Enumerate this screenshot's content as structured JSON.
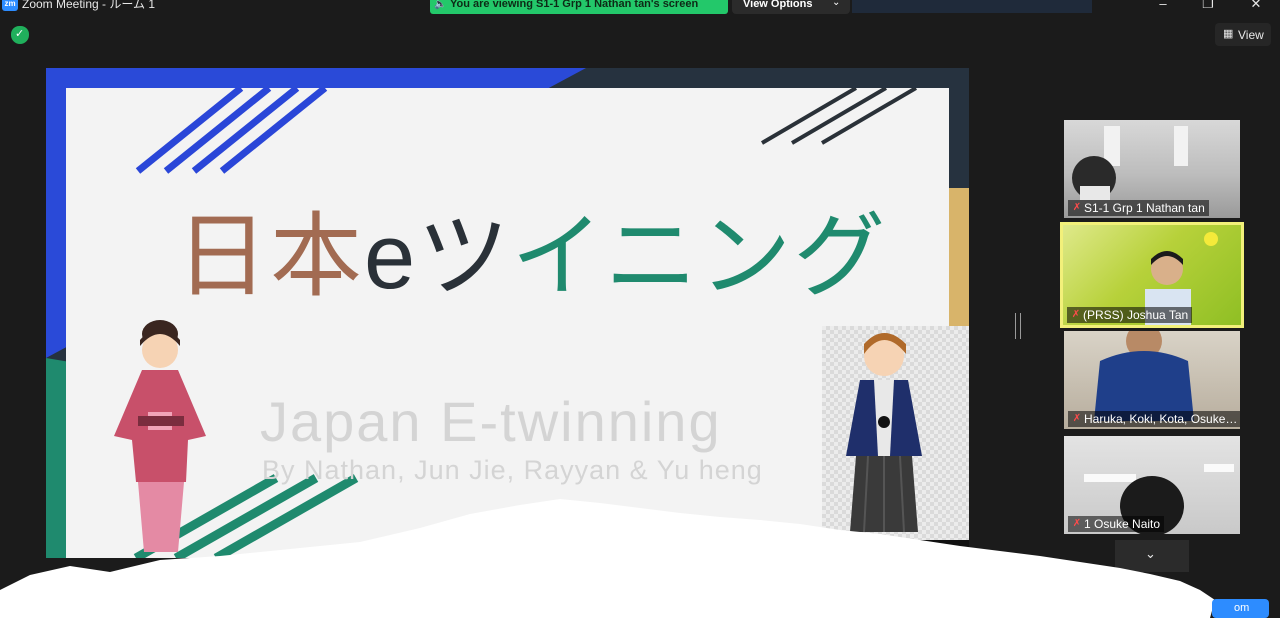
{
  "window": {
    "title": "Zoom Meeting - ルーム 1",
    "logo_text": "zm",
    "controls": {
      "minimize": "–",
      "maximize": "❐",
      "close": "✕"
    }
  },
  "share_banner": {
    "text": "You are viewing S1-1 Grp 1 Nathan tan's screen",
    "color": "#23c86a"
  },
  "view_options": {
    "label": "View Options",
    "chevron": "⌄"
  },
  "view_button": {
    "label": "View"
  },
  "slide": {
    "title_parts": [
      "日本",
      "e",
      "ツ",
      "イニング"
    ],
    "title_colors": [
      "#a26b52",
      "#2a3138",
      "#1f8a6e",
      "#2a46d8"
    ],
    "subtitle": "Japan E-twinning",
    "authors": "By Nathan, Jun Jie, Rayyan & Yu heng"
  },
  "participants": [
    {
      "name": "S1-1 Grp 1 Nathan tan",
      "muted": true,
      "active": false
    },
    {
      "name": "(PRSS) Joshua Tan",
      "muted": true,
      "active": true
    },
    {
      "name": "Haruka, Koki, Kota, Osuke…",
      "muted": true,
      "active": false
    },
    {
      "name": "1 Osuke Naito",
      "muted": true,
      "active": false
    }
  ],
  "more_button": {
    "icon": "⌄"
  },
  "corner_button": {
    "label": "om"
  },
  "colors": {
    "accent": "#2d8cff",
    "active_border": "#f2f07a",
    "mute": "#ff4b4b"
  }
}
